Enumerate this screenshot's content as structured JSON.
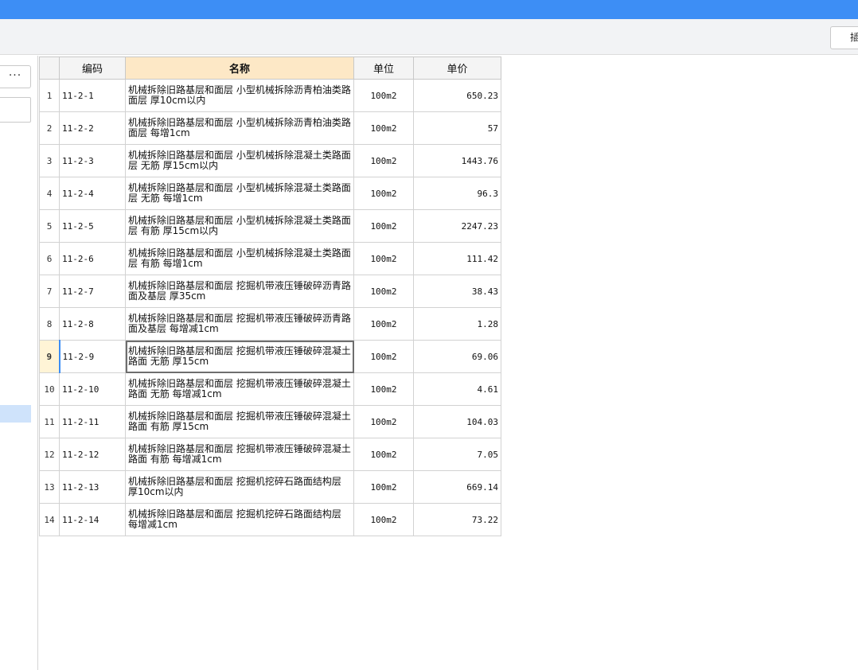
{
  "toolbar": {
    "partial_button_label": "插"
  },
  "left_panel": {
    "more_label": "···"
  },
  "table": {
    "headers": {
      "row_num": "",
      "code": "编码",
      "name": "名称",
      "unit": "单位",
      "price": "单价"
    },
    "selected_row": 9,
    "rows": [
      {
        "num": "1",
        "code": "11-2-1",
        "name": "机械拆除旧路基层和面层 小型机械拆除沥青柏油类路面层 厚10cm以内",
        "unit": "100m2",
        "price": "650.23"
      },
      {
        "num": "2",
        "code": "11-2-2",
        "name": "机械拆除旧路基层和面层 小型机械拆除沥青柏油类路面层 每增1cm",
        "unit": "100m2",
        "price": "57"
      },
      {
        "num": "3",
        "code": "11-2-3",
        "name": "机械拆除旧路基层和面层 小型机械拆除混凝土类路面层 无筋 厚15cm以内",
        "unit": "100m2",
        "price": "1443.76"
      },
      {
        "num": "4",
        "code": "11-2-4",
        "name": "机械拆除旧路基层和面层 小型机械拆除混凝土类路面层 无筋 每增1cm",
        "unit": "100m2",
        "price": "96.3"
      },
      {
        "num": "5",
        "code": "11-2-5",
        "name": "机械拆除旧路基层和面层 小型机械拆除混凝土类路面层 有筋 厚15cm以内",
        "unit": "100m2",
        "price": "2247.23"
      },
      {
        "num": "6",
        "code": "11-2-6",
        "name": "机械拆除旧路基层和面层 小型机械拆除混凝土类路面层 有筋 每增1cm",
        "unit": "100m2",
        "price": "111.42"
      },
      {
        "num": "7",
        "code": "11-2-7",
        "name": "机械拆除旧路基层和面层 挖掘机带液压锤破碎沥青路面及基层 厚35cm",
        "unit": "100m2",
        "price": "38.43"
      },
      {
        "num": "8",
        "code": "11-2-8",
        "name": "机械拆除旧路基层和面层 挖掘机带液压锤破碎沥青路面及基层 每增减1cm",
        "unit": "100m2",
        "price": "1.28"
      },
      {
        "num": "9",
        "code": "11-2-9",
        "name": "机械拆除旧路基层和面层 挖掘机带液压锤破碎混凝土路面 无筋 厚15cm",
        "unit": "100m2",
        "price": "69.06"
      },
      {
        "num": "10",
        "code": "11-2-10",
        "name": "机械拆除旧路基层和面层 挖掘机带液压锤破碎混凝土路面 无筋 每增减1cm",
        "unit": "100m2",
        "price": "4.61"
      },
      {
        "num": "11",
        "code": "11-2-11",
        "name": "机械拆除旧路基层和面层 挖掘机带液压锤破碎混凝土路面 有筋 厚15cm",
        "unit": "100m2",
        "price": "104.03"
      },
      {
        "num": "12",
        "code": "11-2-12",
        "name": "机械拆除旧路基层和面层 挖掘机带液压锤破碎混凝土路面 有筋 每增减1cm",
        "unit": "100m2",
        "price": "7.05"
      },
      {
        "num": "13",
        "code": "11-2-13",
        "name": "机械拆除旧路基层和面层 挖掘机挖碎石路面结构层 厚10cm以内",
        "unit": "100m2",
        "price": "669.14"
      },
      {
        "num": "14",
        "code": "11-2-14",
        "name": "机械拆除旧路基层和面层 挖掘机挖碎石路面结构层 每增减1cm",
        "unit": "100m2",
        "price": "73.22"
      }
    ]
  },
  "colors": {
    "title_bar": "#3d8ef5",
    "name_header": "#fde8c6",
    "selection": "#cfe3fb"
  }
}
